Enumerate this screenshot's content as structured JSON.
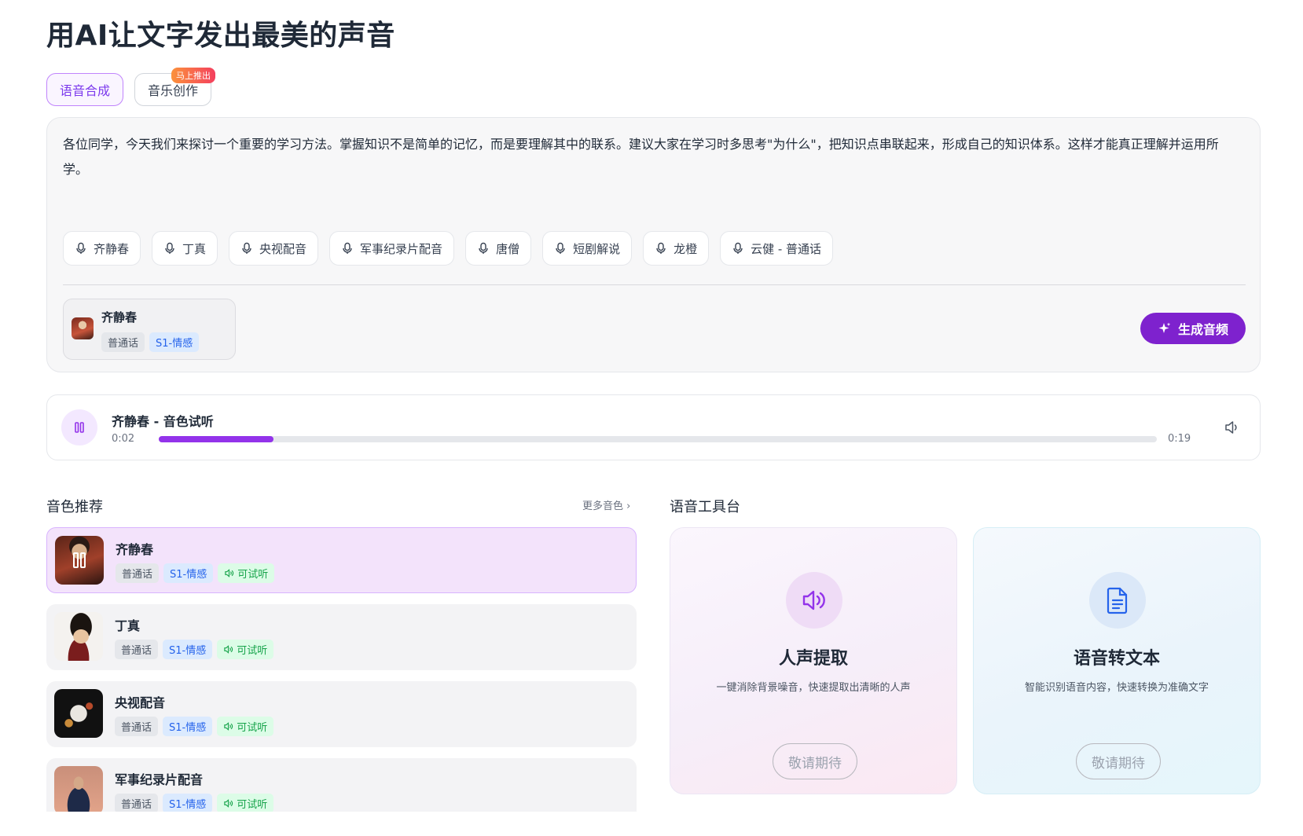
{
  "page": {
    "title": "用AI让文字发出最美的声音"
  },
  "tabs": [
    {
      "label": "语音合成",
      "active": true
    },
    {
      "label": "音乐创作",
      "active": false,
      "badge": "马上推出"
    }
  ],
  "editor": {
    "text": "各位同学，今天我们来探讨一个重要的学习方法。掌握知识不是简单的记忆，而是要理解其中的联系。建议大家在学习时多思考\"为什么\"，把知识点串联起来，形成自己的知识体系。这样才能真正理解并运用所学。",
    "voice_chips": [
      "齐静春",
      "丁真",
      "央视配音",
      "军事纪录片配音",
      "唐僧",
      "短剧解说",
      "龙橙",
      "云健 - 普通话"
    ],
    "selected_voice": {
      "name": "齐静春",
      "tags": [
        "普通话",
        "S1-情感"
      ]
    },
    "generate_label": "生成音频"
  },
  "player": {
    "title": "齐静春 - 音色试听",
    "current_time": "0:02",
    "total_time": "0:19",
    "progress": 0.115
  },
  "recommend": {
    "title": "音色推荐",
    "more_label": "更多音色",
    "tag_lang": "普通话",
    "tag_model": "S1-情感",
    "tag_listen": "可试听",
    "voices": [
      {
        "name": "齐静春",
        "active": true
      },
      {
        "name": "丁真",
        "active": false
      },
      {
        "name": "央视配音",
        "active": false
      },
      {
        "name": "军事纪录片配音",
        "active": false
      }
    ]
  },
  "tools": {
    "title": "语音工具台",
    "cards": [
      {
        "name": "人声提取",
        "desc": "一键消除背景噪音，快速提取出清晰的人声",
        "button": "敬请期待",
        "icon": "speaker-icon"
      },
      {
        "name": "语音转文本",
        "desc": "智能识别语音内容，快速转换为准确文字",
        "button": "敬请期待",
        "icon": "document-icon"
      }
    ]
  },
  "colors": {
    "accent": "#7e22ce",
    "progress": "#9333ea",
    "tag_blue": "#2563eb",
    "tag_green": "#16a34a"
  }
}
